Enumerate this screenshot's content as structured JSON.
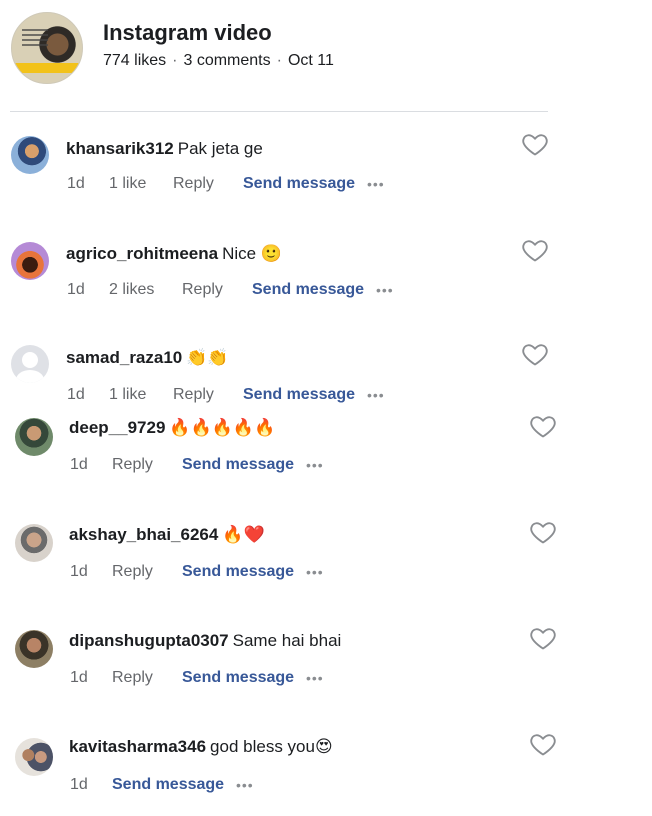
{
  "post": {
    "title": "Instagram video",
    "likes": "774 likes",
    "comments": "3 comments",
    "date": "Oct 11"
  },
  "labels": {
    "reply": "Reply",
    "send_message": "Send message",
    "more": "•••"
  },
  "comments": [
    {
      "username": "khansarik312",
      "text": "Pak jeta ge",
      "time": "1d",
      "likes": "1 like"
    },
    {
      "username": "agrico_rohitmeena",
      "text": "Nice 🙂",
      "time": "1d",
      "likes": "2 likes"
    },
    {
      "username": "samad_raza10",
      "text": "👏👏",
      "time": "1d",
      "likes": "1 like"
    },
    {
      "username": "deep__9729",
      "text": "🔥🔥🔥🔥🔥",
      "time": "1d"
    },
    {
      "username": "akshay_bhai_6264",
      "text": "🔥❤️",
      "time": "1d"
    },
    {
      "username": "dipanshugupta0307",
      "text": "Same hai bhai",
      "time": "1d"
    },
    {
      "username": "kavitasharma346",
      "text": "god bless you😍",
      "time": "1d"
    }
  ],
  "colors": {
    "link": "#385898",
    "secondary_text": "#65676b",
    "divider": "#dadde1"
  },
  "icons": {
    "like": "heart-outline-icon",
    "more": "more-dots-icon"
  }
}
